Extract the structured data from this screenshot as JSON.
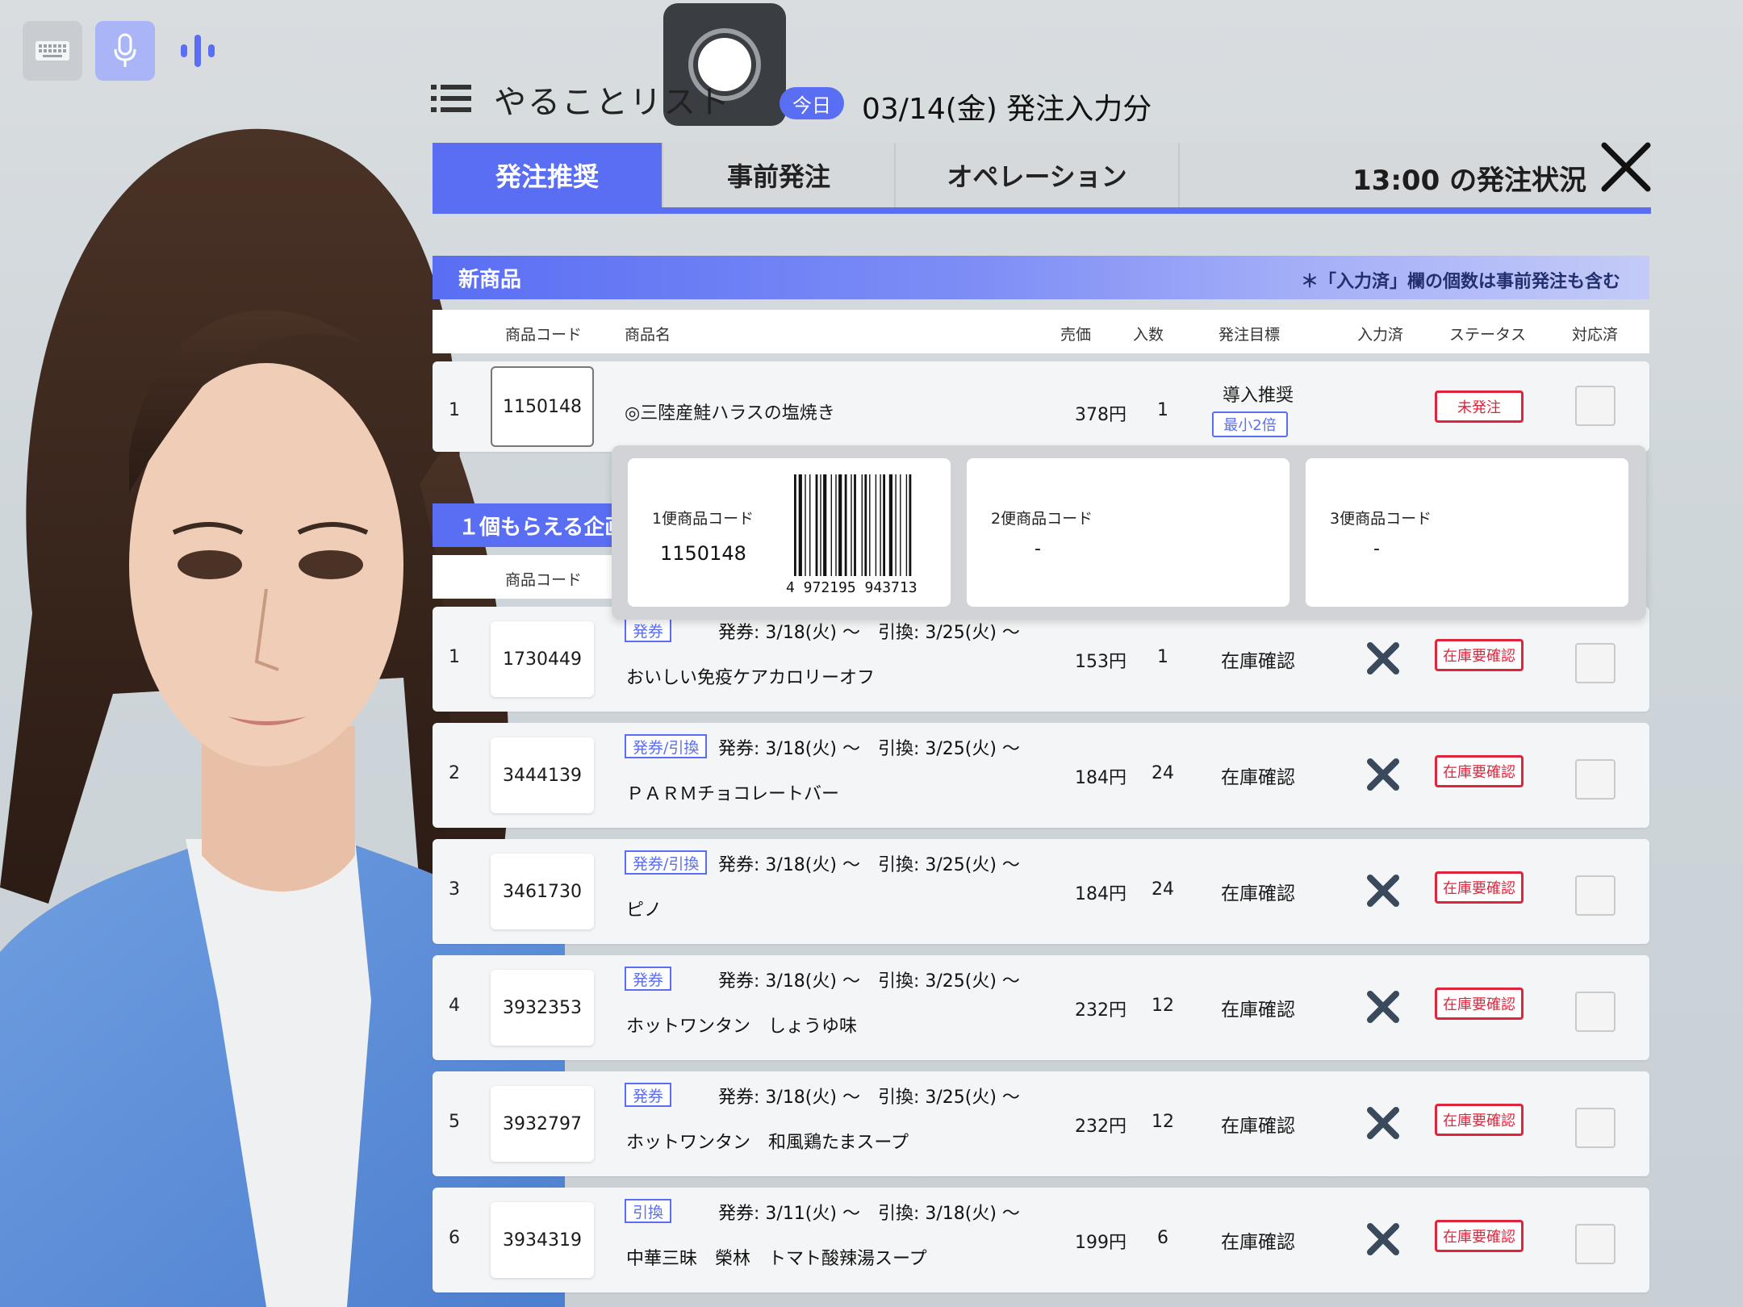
{
  "header": {
    "title": "やることリスト",
    "today_badge": "今日",
    "date_label": "03/14(金) 発注入力分"
  },
  "tabs": [
    {
      "label": "発注推奨",
      "active": true
    },
    {
      "label": "事前発注",
      "active": false
    },
    {
      "label": "オペレーション",
      "active": false
    }
  ],
  "order_status_label": "13:00 の発注状況",
  "colors": {
    "accent": "#5a6ef3",
    "alert": "#e0243c"
  },
  "icons": [
    "keyboard-icon",
    "microphone-icon",
    "audio-wave-icon",
    "record-icon",
    "menu-icon",
    "close-icon",
    "x-mark-icon"
  ],
  "new_products": {
    "section_title": "新商品",
    "note": "＊「入力済」欄の個数は事前発注も含む",
    "columns": [
      "商品コード",
      "商品名",
      "売価",
      "入数",
      "発注目標",
      "入力済",
      "ステータス",
      "対応済"
    ],
    "rows": [
      {
        "num": "1",
        "code": "1150148",
        "name": "◎三陸産鮭ハラスの塩焼き",
        "price": "378円",
        "qty": "1",
        "target": "導入推奨",
        "target_badge": "最小2倍",
        "status": "未発注"
      }
    ]
  },
  "popover": {
    "cards": [
      {
        "label": "1便商品コード",
        "value": "1150148",
        "barcode_text": "4 972195 943713"
      },
      {
        "label": "2便商品コード",
        "value": "-"
      },
      {
        "label": "3便商品コード",
        "value": "-"
      }
    ]
  },
  "campaign": {
    "section_title": "１個もらえる企画",
    "column_code": "商品コード",
    "rows": [
      {
        "num": "1",
        "code": "1730449",
        "tag": "発券",
        "period": "発券: 3/18(火) 〜　引換: 3/25(火) 〜",
        "name": "おいしい免疫ケアカロリーオフ",
        "price": "153円",
        "qty": "1",
        "target": "在庫確認",
        "status": "在庫要確認"
      },
      {
        "num": "2",
        "code": "3444139",
        "tag": "発券/引換",
        "period": "発券: 3/18(火) 〜　引換: 3/25(火) 〜",
        "name": "ＰＡＲＭチョコレートバー",
        "price": "184円",
        "qty": "24",
        "target": "在庫確認",
        "status": "在庫要確認"
      },
      {
        "num": "3",
        "code": "3461730",
        "tag": "発券/引換",
        "period": "発券: 3/18(火) 〜　引換: 3/25(火) 〜",
        "name": "ピノ",
        "price": "184円",
        "qty": "24",
        "target": "在庫確認",
        "status": "在庫要確認"
      },
      {
        "num": "4",
        "code": "3932353",
        "tag": "発券",
        "period": "発券: 3/18(火) 〜　引換: 3/25(火) 〜",
        "name": "ホットワンタン　しょうゆ味",
        "price": "232円",
        "qty": "12",
        "target": "在庫確認",
        "status": "在庫要確認"
      },
      {
        "num": "5",
        "code": "3932797",
        "tag": "発券",
        "period": "発券: 3/18(火) 〜　引換: 3/25(火) 〜",
        "name": "ホットワンタン　和風鶏たまスープ",
        "price": "232円",
        "qty": "12",
        "target": "在庫確認",
        "status": "在庫要確認"
      },
      {
        "num": "6",
        "code": "3934319",
        "tag": "引換",
        "period": "発券: 3/11(火) 〜　引換: 3/18(火) 〜",
        "name": "中華三昧　榮林　トマト酸辣湯スープ",
        "price": "199円",
        "qty": "6",
        "target": "在庫確認",
        "status": "在庫要確認"
      }
    ]
  }
}
